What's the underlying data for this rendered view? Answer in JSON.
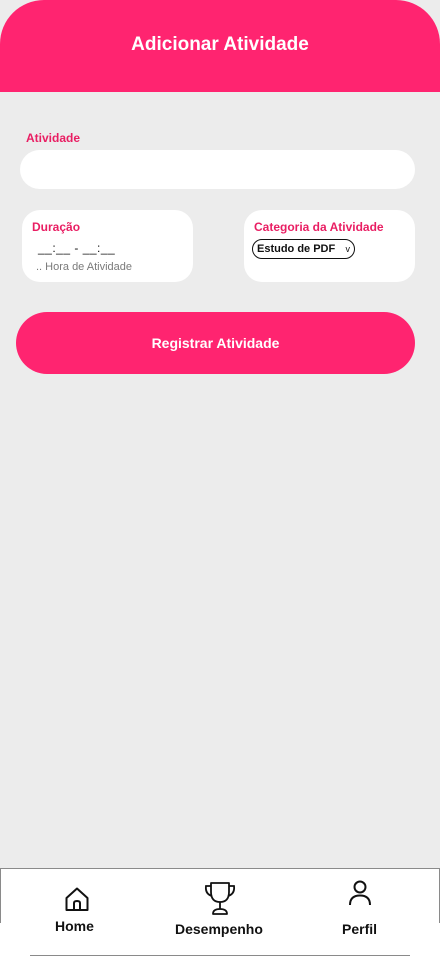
{
  "header": {
    "title": "Adicionar Atividade"
  },
  "form": {
    "atividade": {
      "label": "Atividade",
      "value": "",
      "placeholder": ""
    },
    "duracao": {
      "label": "Duração",
      "value": "__:__ - __:__",
      "hint": ".. Hora de Atividade"
    },
    "categoria": {
      "label": "Categoria da Atividade",
      "selected": "Estudo de PDF",
      "chevron": "v"
    },
    "submit_label": "Registrar Atividade"
  },
  "nav": {
    "items": [
      {
        "label": "Home",
        "icon": "home-icon"
      },
      {
        "label": "Desempenho",
        "icon": "trophy-icon"
      },
      {
        "label": "Perfil",
        "icon": "user-icon"
      }
    ]
  },
  "colors": {
    "accent": "#ff2470",
    "label": "#e91e63",
    "background": "#ececec"
  }
}
